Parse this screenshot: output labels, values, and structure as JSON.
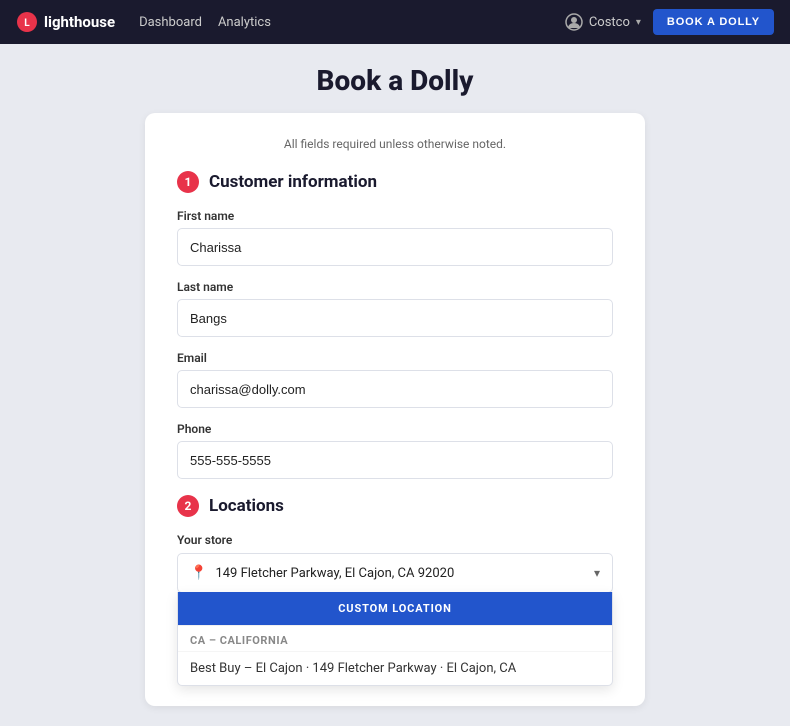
{
  "app": {
    "name": "lighthouse",
    "nav": {
      "dashboard_label": "Dashboard",
      "analytics_label": "Analytics",
      "user_name": "Costco",
      "book_btn_label": "BOOK A DOLLY"
    }
  },
  "page": {
    "title": "Book a Dolly",
    "form_note": "All fields required unless otherwise noted."
  },
  "section1": {
    "number": "1",
    "title": "Customer information",
    "first_name_label": "First name",
    "first_name_value": "Charissa",
    "last_name_label": "Last name",
    "last_name_value": "Bangs",
    "email_label": "Email",
    "email_value": "charissa@dolly.com",
    "phone_label": "Phone",
    "phone_value": "555-555-5555"
  },
  "section2": {
    "number": "2",
    "title": "Locations",
    "store_label": "Your store",
    "store_selected": "149 Fletcher Parkway, El Cajon, CA 92020",
    "dropdown": {
      "custom_btn_label": "CUSTOM LOCATION",
      "group_label": "CA – CALIFORNIA",
      "partial_item": "Best Buy – El Cajon · 149 Fletcher Parkway · El Cajon, CA"
    }
  }
}
